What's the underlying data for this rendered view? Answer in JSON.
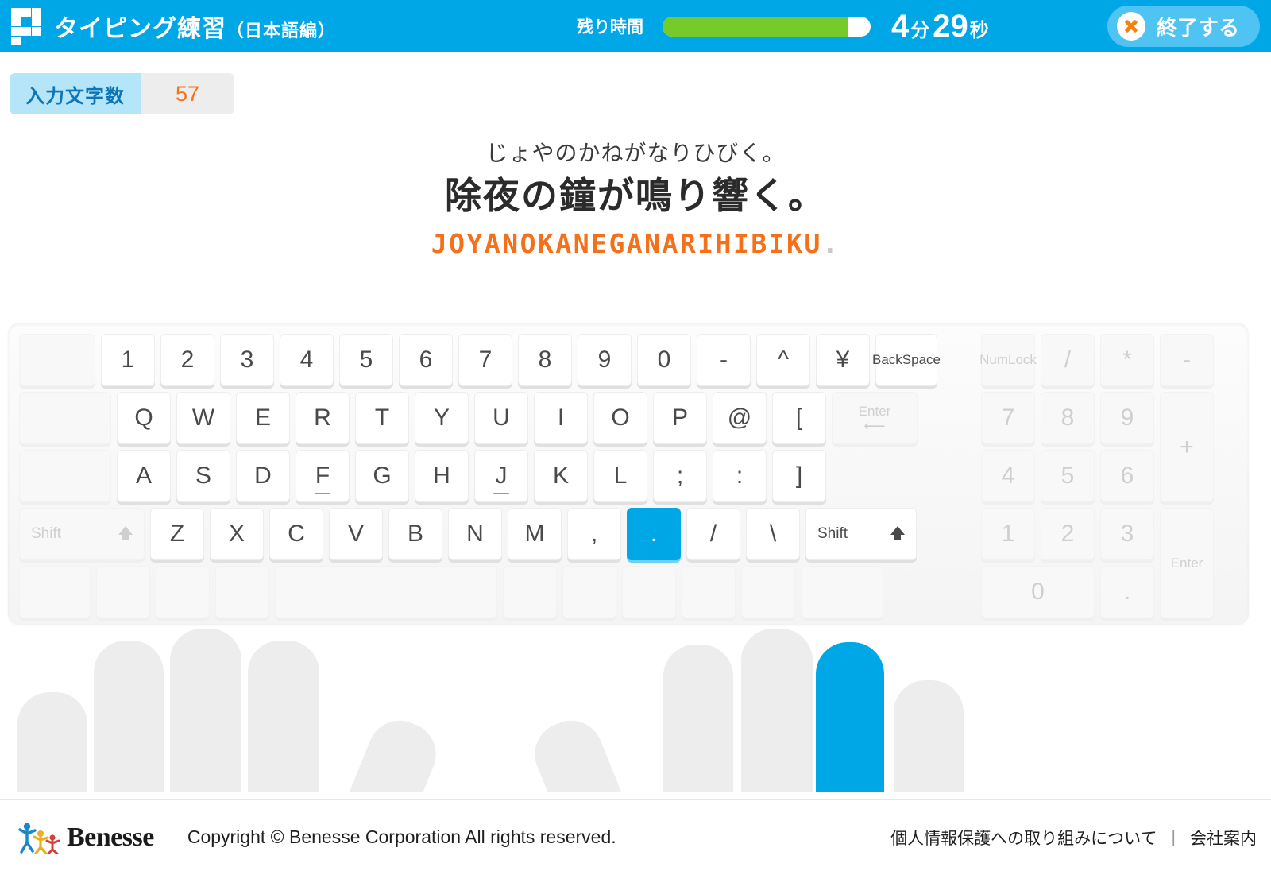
{
  "header": {
    "title_main": "タイピング練習",
    "title_sub": "（日本語編）",
    "logo_name": "benesse-grid-logo",
    "timer_label": "残り時間",
    "timer_minutes": "4",
    "timer_minutes_unit": "分",
    "timer_seconds": "29",
    "timer_seconds_unit": "秒",
    "timer_progress_percent": 89,
    "end_button_label": "終了する",
    "bg_color": "#00A7E7",
    "progress_fill_color": "#76CB2B",
    "end_button_color": "#4FC3F2",
    "x_icon_color": "#F5820A"
  },
  "counter": {
    "label": "入力文字数",
    "value": "57",
    "label_bg": "#B5E5F8",
    "label_color": "#0C76B8",
    "value_color": "#F4741A"
  },
  "prompt": {
    "kana": "じょやのかねがなりひびく。",
    "kanji": "除夜の鐘が鳴り響く。",
    "romaji_typed": "JOYANOKANEGANARIHIBIKU",
    "romaji_remaining": ".",
    "typed_color": "#F5701A",
    "remaining_color": "#C8C8C8"
  },
  "keyboard": {
    "active_key": ".",
    "active_key_color": "#00A7E7",
    "rows": [
      {
        "name": "number-row",
        "keys": [
          {
            "label": "",
            "style": "blank",
            "width": "w-blank1"
          },
          {
            "label": "1"
          },
          {
            "label": "2"
          },
          {
            "label": "3"
          },
          {
            "label": "4"
          },
          {
            "label": "5"
          },
          {
            "label": "6"
          },
          {
            "label": "7"
          },
          {
            "label": "8"
          },
          {
            "label": "9"
          },
          {
            "label": "0"
          },
          {
            "label": "-"
          },
          {
            "label": "^"
          },
          {
            "label": "¥"
          },
          {
            "label": "Back Space",
            "style": "small",
            "width": "w-back"
          }
        ]
      },
      {
        "name": "top-row",
        "keys": [
          {
            "label": "",
            "style": "blank",
            "width": "w-blank2"
          },
          {
            "label": "Q"
          },
          {
            "label": "W"
          },
          {
            "label": "E"
          },
          {
            "label": "R"
          },
          {
            "label": "T"
          },
          {
            "label": "Y"
          },
          {
            "label": "U"
          },
          {
            "label": "I"
          },
          {
            "label": "O"
          },
          {
            "label": "P"
          },
          {
            "label": "@"
          },
          {
            "label": "["
          },
          {
            "label": "Enter",
            "style": "ghost",
            "width": "w-enter"
          }
        ]
      },
      {
        "name": "home-row",
        "keys": [
          {
            "label": "",
            "style": "blank",
            "width": "w-blank2"
          },
          {
            "label": "A"
          },
          {
            "label": "S"
          },
          {
            "label": "D"
          },
          {
            "label": "F",
            "homing": true
          },
          {
            "label": "G"
          },
          {
            "label": "H"
          },
          {
            "label": "J",
            "homing": true
          },
          {
            "label": "K"
          },
          {
            "label": "L"
          },
          {
            "label": ";"
          },
          {
            "label": ":"
          },
          {
            "label": "]"
          }
        ]
      },
      {
        "name": "bottom-row",
        "keys": [
          {
            "label": "Shift",
            "style": "ghost shiftkey",
            "width": "w-shiftL",
            "arrow": true
          },
          {
            "label": "Z"
          },
          {
            "label": "X"
          },
          {
            "label": "C"
          },
          {
            "label": "V"
          },
          {
            "label": "B"
          },
          {
            "label": "N"
          },
          {
            "label": "M"
          },
          {
            "label": ","
          },
          {
            "label": ".",
            "active": true
          },
          {
            "label": "/"
          },
          {
            "label": "\\"
          },
          {
            "label": "Shift",
            "style": "shiftkey",
            "width": "w-shiftR",
            "arrow": true
          }
        ]
      },
      {
        "name": "space-row",
        "keys": [
          {
            "label": "",
            "style": "blank",
            "width": "w-b2"
          },
          {
            "label": "",
            "style": "blank",
            "width": "w-b1"
          },
          {
            "label": "",
            "style": "blank",
            "width": "w-b1"
          },
          {
            "label": "",
            "style": "blank",
            "width": "w-b1"
          },
          {
            "label": "",
            "style": "blank",
            "width": "w-space"
          },
          {
            "label": "",
            "style": "blank",
            "width": "w-b1"
          },
          {
            "label": "",
            "style": "blank",
            "width": "w-b1"
          },
          {
            "label": "",
            "style": "blank",
            "width": "w-b1"
          },
          {
            "label": "",
            "style": "blank",
            "width": "w-b1"
          },
          {
            "label": "",
            "style": "blank",
            "width": "w-b1"
          },
          {
            "label": "",
            "style": "blank",
            "width": "w-b3"
          }
        ]
      }
    ],
    "numpad_rows": [
      {
        "name": "numpad-row-1",
        "keys": [
          {
            "label": "Num Lock",
            "style": "ghost small"
          },
          {
            "label": "/",
            "style": "ghost"
          },
          {
            "label": "*",
            "style": "ghost"
          },
          {
            "label": "-",
            "style": "ghost"
          }
        ]
      },
      {
        "name": "numpad-row-2",
        "keys": [
          {
            "label": "7",
            "style": "ghost"
          },
          {
            "label": "8",
            "style": "ghost"
          },
          {
            "label": "9",
            "style": "ghost"
          },
          {
            "label": "+",
            "style": "ghost",
            "tall": true
          }
        ]
      },
      {
        "name": "numpad-row-3",
        "keys": [
          {
            "label": "4",
            "style": "ghost"
          },
          {
            "label": "5",
            "style": "ghost"
          },
          {
            "label": "6",
            "style": "ghost"
          }
        ]
      },
      {
        "name": "numpad-row-4",
        "keys": [
          {
            "label": "1",
            "style": "ghost"
          },
          {
            "label": "2",
            "style": "ghost"
          },
          {
            "label": "3",
            "style": "ghost"
          },
          {
            "label": "Enter",
            "style": "ghost small",
            "tall": true
          }
        ]
      },
      {
        "name": "numpad-row-5",
        "keys": [
          {
            "label": "0",
            "style": "ghost",
            "width": "w-pad0"
          },
          {
            "label": ".",
            "style": "ghost"
          }
        ]
      }
    ]
  },
  "hands": {
    "highlight_color": "#00A7E7",
    "base_color": "#EDEDED",
    "highlighted_finger": "right-ring-finger"
  },
  "footer": {
    "brand": "Benesse",
    "copyright": "Copyright © Benesse Corporation All rights reserved.",
    "link_privacy": "個人情報保護への取り組みについて",
    "separator": "|",
    "link_company": "会社案内"
  }
}
